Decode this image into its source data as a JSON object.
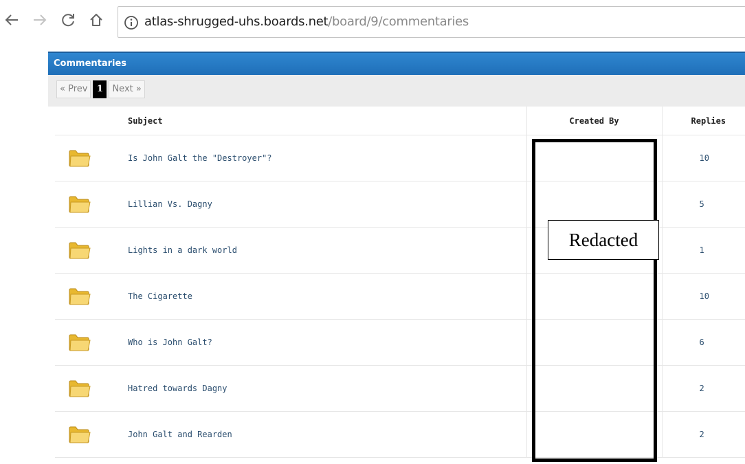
{
  "browser": {
    "url_host": "atlas-shrugged-uhs.boards.net",
    "url_path": "/board/9/commentaries"
  },
  "board": {
    "title": "Commentaries",
    "pager": {
      "prev": "« Prev",
      "current": "1",
      "next": "Next »"
    },
    "columns": {
      "subject": "Subject",
      "created_by": "Created By",
      "replies": "Replies"
    },
    "threads": [
      {
        "subject": "Is John Galt the \"Destroyer\"?",
        "replies": "10"
      },
      {
        "subject": "Lillian Vs. Dagny",
        "replies": "5"
      },
      {
        "subject": "Lights in a dark world",
        "replies": "1"
      },
      {
        "subject": "The Cigarette",
        "replies": "10"
      },
      {
        "subject": "Who is John Galt?",
        "replies": "6"
      },
      {
        "subject": "Hatred towards Dagny",
        "replies": "2"
      },
      {
        "subject": "John Galt and Rearden",
        "replies": "2"
      }
    ]
  },
  "redaction": {
    "label": "Redacted"
  },
  "colors": {
    "header_blue": "#2478c4",
    "link": "#2a4d6e",
    "folder": "#f2c94c"
  },
  "icons": [
    "back-arrow-icon",
    "forward-arrow-icon",
    "reload-icon",
    "home-icon",
    "info-icon",
    "folder-icon"
  ]
}
